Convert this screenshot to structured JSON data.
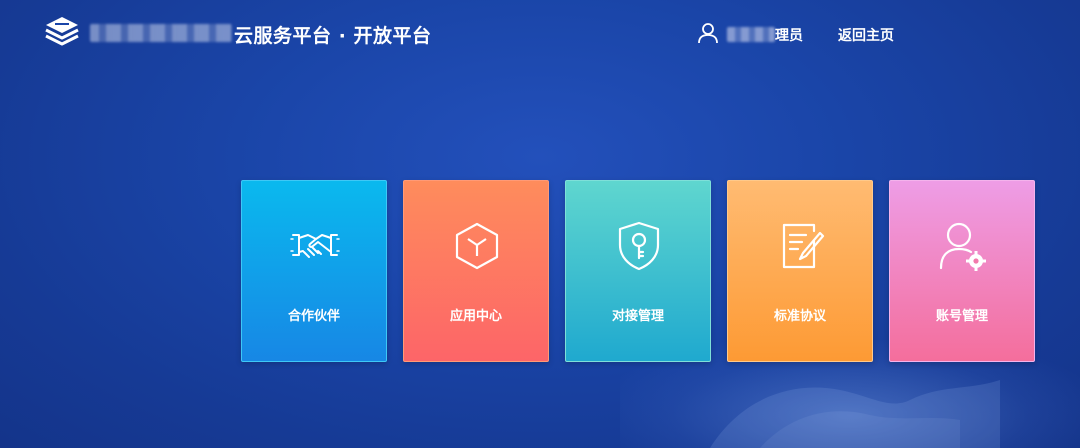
{
  "header": {
    "logo_icon": "layered-books-icon",
    "brand_title": "云服务平台 · 开放平台",
    "user_icon": "user-icon",
    "user_name": "理员",
    "home_link": "返回主页"
  },
  "cards": [
    {
      "label": "合作伙伴",
      "icon": "handshake-icon",
      "colors": [
        "#0ab9ee",
        "#1787e5"
      ]
    },
    {
      "label": "应用中心",
      "icon": "cube-icon",
      "colors": [
        "#fe8c5c",
        "#fd6568"
      ]
    },
    {
      "label": "对接管理",
      "icon": "shield-key-icon",
      "colors": [
        "#5fd6cf",
        "#1fa9cf"
      ]
    },
    {
      "label": "标准协议",
      "icon": "document-edit-icon",
      "colors": [
        "#ffbb72",
        "#fd9a34"
      ]
    },
    {
      "label": "账号管理",
      "icon": "user-settings-icon",
      "colors": [
        "#ee9de6",
        "#f46e9c"
      ]
    }
  ],
  "theme": {
    "background": "#1a45a8",
    "text": "#ffffff"
  }
}
